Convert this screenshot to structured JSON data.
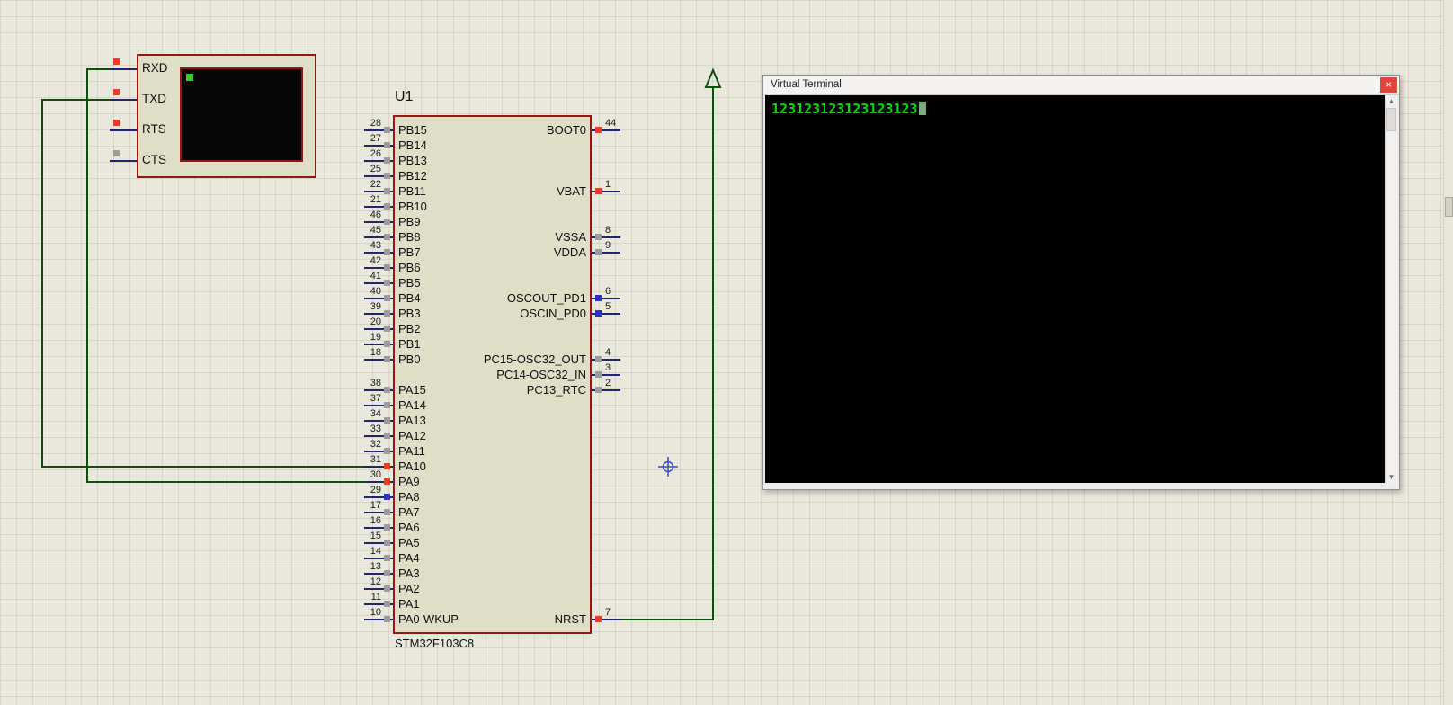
{
  "colors": {
    "wire_green": "#0d4f0d",
    "component_outline": "#8e1b12",
    "state_red": "#f93822",
    "state_blue": "#2633c5",
    "state_grey": "#9b9b9b",
    "terminal_text_green": "#00da00"
  },
  "terminal_component": {
    "pins": [
      {
        "label": "RXD",
        "state": "red"
      },
      {
        "label": "TXD",
        "state": "red"
      },
      {
        "label": "RTS",
        "state": "red"
      },
      {
        "label": "CTS",
        "state": "grey"
      }
    ]
  },
  "mcu": {
    "ref": "U1",
    "part": "STM32F103C8",
    "left_pins": [
      {
        "num": "28",
        "name": "PB15",
        "row": 0,
        "state": "grey"
      },
      {
        "num": "27",
        "name": "PB14",
        "row": 1,
        "state": "grey"
      },
      {
        "num": "26",
        "name": "PB13",
        "row": 2,
        "state": "grey"
      },
      {
        "num": "25",
        "name": "PB12",
        "row": 3,
        "state": "grey"
      },
      {
        "num": "22",
        "name": "PB11",
        "row": 4,
        "state": "grey"
      },
      {
        "num": "21",
        "name": "PB10",
        "row": 5,
        "state": "grey"
      },
      {
        "num": "46",
        "name": "PB9",
        "row": 6,
        "state": "grey"
      },
      {
        "num": "45",
        "name": "PB8",
        "row": 7,
        "state": "grey"
      },
      {
        "num": "43",
        "name": "PB7",
        "row": 8,
        "state": "grey"
      },
      {
        "num": "42",
        "name": "PB6",
        "row": 9,
        "state": "grey"
      },
      {
        "num": "41",
        "name": "PB5",
        "row": 10,
        "state": "grey"
      },
      {
        "num": "40",
        "name": "PB4",
        "row": 11,
        "state": "grey"
      },
      {
        "num": "39",
        "name": "PB3",
        "row": 12,
        "state": "grey"
      },
      {
        "num": "20",
        "name": "PB2",
        "row": 13,
        "state": "grey"
      },
      {
        "num": "19",
        "name": "PB1",
        "row": 14,
        "state": "grey"
      },
      {
        "num": "18",
        "name": "PB0",
        "row": 15,
        "state": "grey"
      },
      {
        "num": "38",
        "name": "PA15",
        "row": 17,
        "state": "grey"
      },
      {
        "num": "37",
        "name": "PA14",
        "row": 18,
        "state": "grey"
      },
      {
        "num": "34",
        "name": "PA13",
        "row": 19,
        "state": "grey"
      },
      {
        "num": "33",
        "name": "PA12",
        "row": 20,
        "state": "grey"
      },
      {
        "num": "32",
        "name": "PA11",
        "row": 21,
        "state": "grey"
      },
      {
        "num": "31",
        "name": "PA10",
        "row": 22,
        "state": "red"
      },
      {
        "num": "30",
        "name": "PA9",
        "row": 23,
        "state": "red"
      },
      {
        "num": "29",
        "name": "PA8",
        "row": 24,
        "state": "blue"
      },
      {
        "num": "17",
        "name": "PA7",
        "row": 25,
        "state": "grey"
      },
      {
        "num": "16",
        "name": "PA6",
        "row": 26,
        "state": "grey"
      },
      {
        "num": "15",
        "name": "PA5",
        "row": 27,
        "state": "grey"
      },
      {
        "num": "14",
        "name": "PA4",
        "row": 28,
        "state": "grey"
      },
      {
        "num": "13",
        "name": "PA3",
        "row": 29,
        "state": "grey"
      },
      {
        "num": "12",
        "name": "PA2",
        "row": 30,
        "state": "grey"
      },
      {
        "num": "11",
        "name": "PA1",
        "row": 31,
        "state": "grey"
      },
      {
        "num": "10",
        "name": "PA0-WKUP",
        "row": 32,
        "state": "grey"
      }
    ],
    "right_pins": [
      {
        "num": "44",
        "name": "BOOT0",
        "row": 0,
        "state": "red"
      },
      {
        "num": "1",
        "name": "VBAT",
        "row": 4,
        "state": "red"
      },
      {
        "num": "8",
        "name": "VSSA",
        "row": 7,
        "state": "grey"
      },
      {
        "num": "9",
        "name": "VDDA",
        "row": 8,
        "state": "grey"
      },
      {
        "num": "6",
        "name": "OSCOUT_PD1",
        "row": 11,
        "state": "blue"
      },
      {
        "num": "5",
        "name": "OSCIN_PD0",
        "row": 12,
        "state": "blue"
      },
      {
        "num": "4",
        "name": "PC15-OSC32_OUT",
        "row": 15,
        "state": "grey"
      },
      {
        "num": "3",
        "name": "PC14-OSC32_IN",
        "row": 16,
        "state": "grey"
      },
      {
        "num": "2",
        "name": "PC13_RTC",
        "row": 17,
        "state": "grey"
      },
      {
        "num": "7",
        "name": "NRST",
        "row": 32,
        "state": "red"
      }
    ]
  },
  "vt_window": {
    "title": "Virtual Terminal",
    "close_glyph": "×",
    "output_text": "123123123123123123",
    "scroll_up_glyph": "▲",
    "scroll_down_glyph": "▼"
  }
}
